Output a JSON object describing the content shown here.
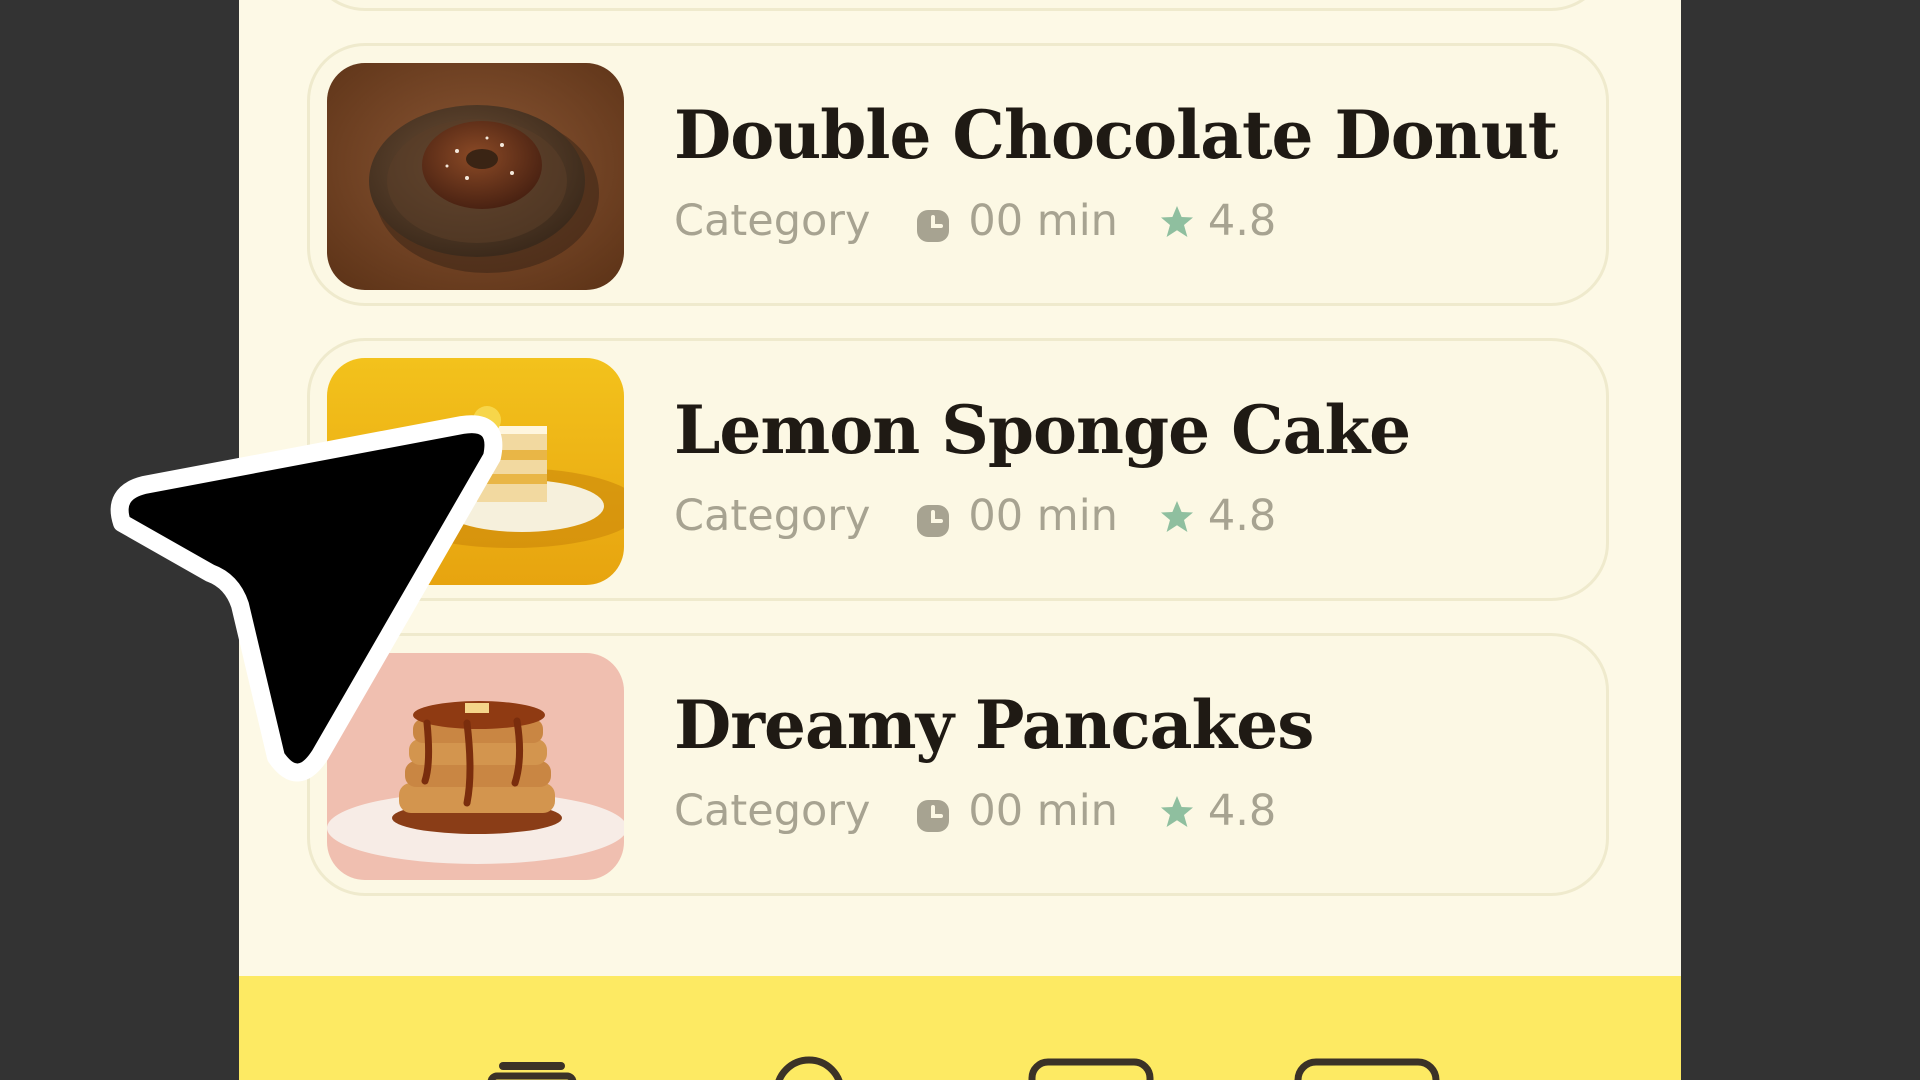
{
  "recipes": [
    {
      "title": "Double Chocolate Donut",
      "category": "Category",
      "duration": "00 min",
      "rating": "4.8",
      "image_icon": "donut-photo"
    },
    {
      "title": "Lemon Sponge Cake",
      "category": "Category",
      "duration": "00 min",
      "rating": "4.8",
      "image_icon": "lemon-cake-photo"
    },
    {
      "title": "Dreamy Pancakes",
      "category": "Category",
      "duration": "00 min",
      "rating": "4.8",
      "image_icon": "pancakes-photo"
    }
  ],
  "nav": {
    "icons": [
      "home-icon",
      "search-icon",
      "bookmark-icon",
      "profile-icon"
    ]
  },
  "colors": {
    "background": "#fdf9e6",
    "navbar": "#fdea63",
    "star": "#8fbf9f",
    "meta_text": "#a7a391",
    "title_text": "#1f1a14"
  }
}
